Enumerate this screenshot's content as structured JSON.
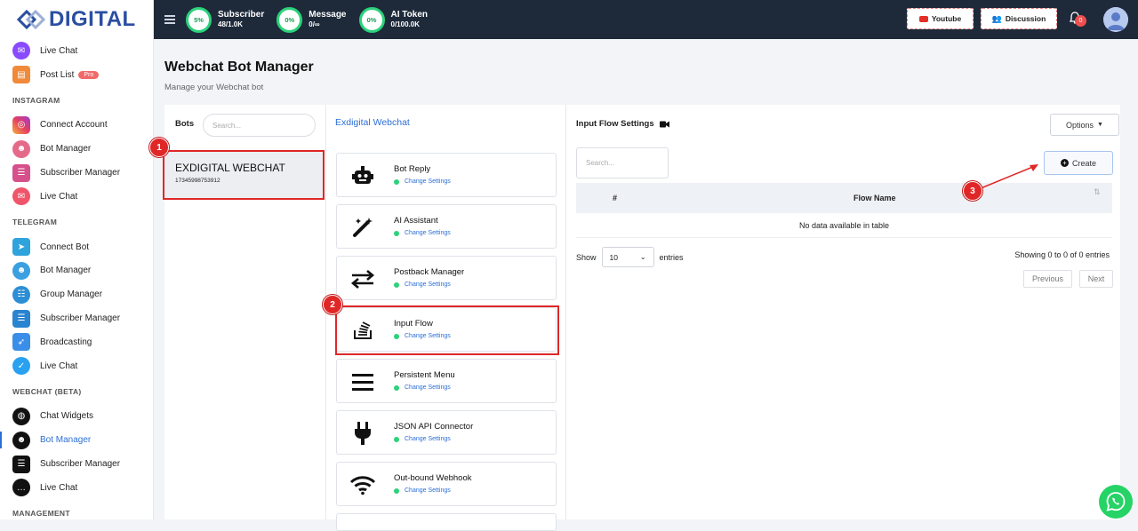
{
  "app": {
    "logo_text": "DIGITAL"
  },
  "sidebar": {
    "items": [
      {
        "label": "Live Chat",
        "icon": "messenger-icon",
        "color": "#8a4bff"
      },
      {
        "label": "Post List",
        "icon": "post-list-icon",
        "color": "#f08a3a",
        "badge": "Pro"
      }
    ],
    "instagram": {
      "heading": "INSTAGRAM",
      "items": [
        {
          "label": "Connect Account",
          "icon": "instagram-icon",
          "color": "#e4405f"
        },
        {
          "label": "Bot Manager",
          "icon": "bot-icon",
          "color": "#e56a8a"
        },
        {
          "label": "Subscriber Manager",
          "icon": "subscriber-icon",
          "color": "#d6508c"
        },
        {
          "label": "Live Chat",
          "icon": "chat-icon",
          "color": "#f0556a"
        }
      ]
    },
    "telegram": {
      "heading": "TELEGRAM",
      "items": [
        {
          "label": "Connect Bot",
          "icon": "telegram-icon",
          "color": "#2ea3dc"
        },
        {
          "label": "Bot Manager",
          "icon": "bot-icon",
          "color": "#3aa0e0"
        },
        {
          "label": "Group Manager",
          "icon": "group-icon",
          "color": "#2c8fd6"
        },
        {
          "label": "Subscriber Manager",
          "icon": "subscriber-icon",
          "color": "#2a84cf"
        },
        {
          "label": "Broadcasting",
          "icon": "broadcast-icon",
          "color": "#3b8ee8"
        },
        {
          "label": "Live Chat",
          "icon": "chat-check-icon",
          "color": "#2aa1f0"
        }
      ]
    },
    "webchat": {
      "heading": "WEBCHAT (BETA)",
      "items": [
        {
          "label": "Chat Widgets",
          "icon": "globe-icon",
          "color": "#111111"
        },
        {
          "label": "Bot Manager",
          "icon": "bot-icon",
          "color": "#111111",
          "active": true
        },
        {
          "label": "Subscriber Manager",
          "icon": "subscriber-icon",
          "color": "#111111"
        },
        {
          "label": "Live Chat",
          "icon": "chat-icon",
          "color": "#111111"
        }
      ]
    },
    "management_heading": "MANAGEMENT"
  },
  "topbar": {
    "stats": [
      {
        "pct": "5%",
        "title": "Subscriber",
        "value": "48/1.0K"
      },
      {
        "pct": "0%",
        "title": "Message",
        "value": "0/∞"
      },
      {
        "pct": "0%",
        "title": "AI Token",
        "value": "0/100.0K"
      }
    ],
    "youtube_label": "Youtube",
    "discussion_label": "Discussion",
    "notification_count": "0"
  },
  "page": {
    "title": "Webchat Bot Manager",
    "subtitle": "Manage your Webchat bot"
  },
  "bots": {
    "label": "Bots",
    "search_placeholder": "Search...",
    "selected": {
      "name": "EXDIGITAL WEBCHAT",
      "id": "17345998753912"
    }
  },
  "settings_column": {
    "title": "Exdigital Webchat",
    "change_label": "Change Settings",
    "options": [
      {
        "title": "Bot Reply",
        "icon": "robot-icon"
      },
      {
        "title": "AI Assistant",
        "icon": "magic-wand-icon"
      },
      {
        "title": "Postback Manager",
        "icon": "arrows-swap-icon"
      },
      {
        "title": "Input Flow",
        "icon": "stack-tray-icon"
      },
      {
        "title": "Persistent Menu",
        "icon": "menu-lines-icon"
      },
      {
        "title": "JSON API Connector",
        "icon": "plug-icon"
      },
      {
        "title": "Out-bound Webhook",
        "icon": "wifi-icon"
      }
    ]
  },
  "flow": {
    "header": "Input Flow Settings",
    "options_label": "Options",
    "search_placeholder": "Search...",
    "create_label": "Create",
    "columns": [
      "#",
      "Flow Name",
      "⇅"
    ],
    "empty_text": "No data available in table",
    "show_label": "Show",
    "entries_value": "10",
    "entries_label": "entries",
    "info": "Showing 0 to 0 of 0 entries",
    "prev_label": "Previous",
    "next_label": "Next"
  },
  "annotations": [
    "1",
    "2",
    "3"
  ]
}
